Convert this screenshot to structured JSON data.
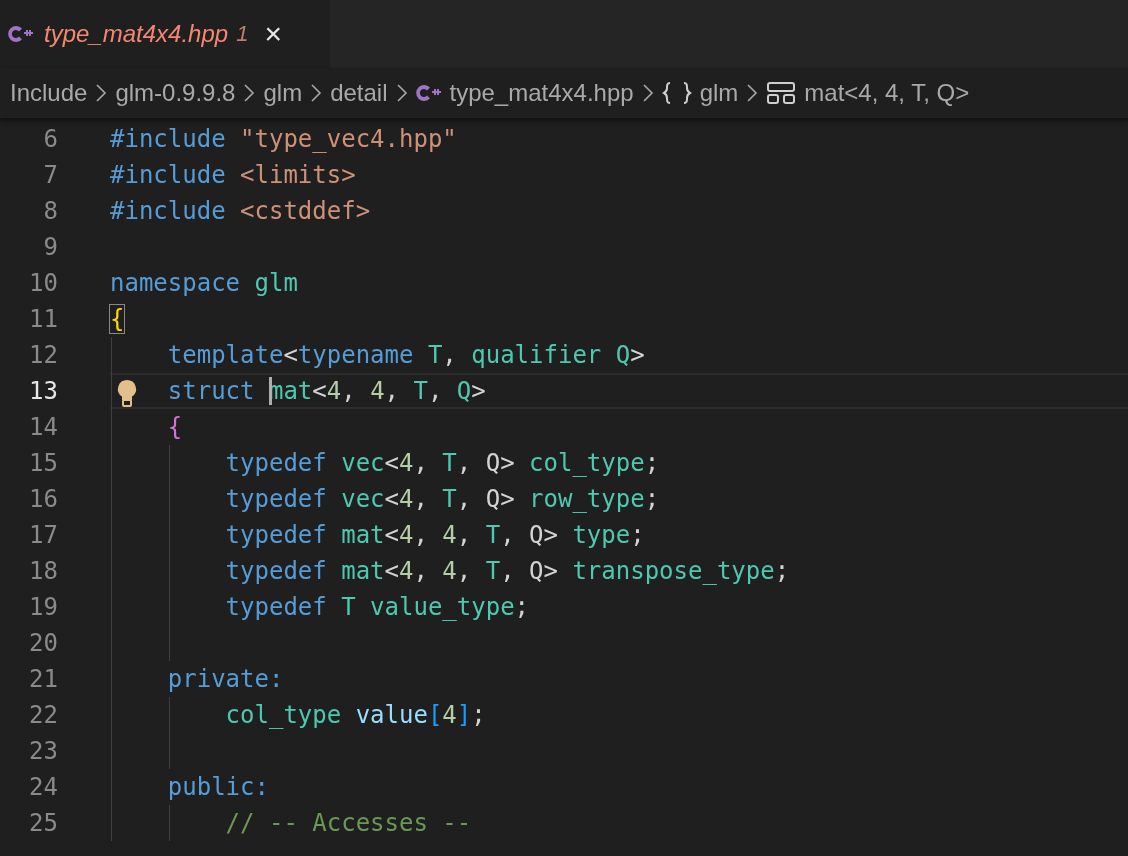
{
  "tab": {
    "title": "type_mat4x4.hpp",
    "problems": "1",
    "preview": true,
    "selected": true,
    "close": "×"
  },
  "breadcrumbs": [
    {
      "kind": "folder",
      "label": "Include"
    },
    {
      "kind": "folder",
      "label": "glm-0.9.9.8"
    },
    {
      "kind": "folder",
      "label": "glm"
    },
    {
      "kind": "folder",
      "label": "detail"
    },
    {
      "kind": "file",
      "label": "type_mat4x4.hpp"
    },
    {
      "kind": "namespace",
      "label": "glm"
    },
    {
      "kind": "struct",
      "label": "mat<4, 4, T, Q>"
    }
  ],
  "editor": {
    "lines": [
      {
        "number": "6",
        "current": false,
        "lightbulb": false,
        "tokens": [
          {
            "kind": "directive",
            "text": "#include "
          },
          {
            "kind": "string",
            "text": "\"type_vec4.hpp\""
          }
        ]
      },
      {
        "number": "7",
        "current": false,
        "lightbulb": false,
        "tokens": [
          {
            "kind": "directive",
            "text": "#include "
          },
          {
            "kind": "string",
            "text": "<limits>"
          }
        ]
      },
      {
        "number": "8",
        "current": false,
        "lightbulb": false,
        "tokens": [
          {
            "kind": "directive",
            "text": "#include "
          },
          {
            "kind": "string",
            "text": "<cstddef>"
          }
        ]
      },
      {
        "number": "9",
        "current": false,
        "lightbulb": false
      },
      {
        "number": "10",
        "current": false,
        "lightbulb": false,
        "tokens": [
          {
            "kind": "keyword",
            "text": "namespace "
          },
          {
            "kind": "type",
            "text": "glm"
          }
        ]
      },
      {
        "number": "11",
        "current": false,
        "lightbulb": false,
        "tokens": [
          {
            "kind": "brace-outer",
            "text": "{",
            "matched": true
          }
        ]
      },
      {
        "number": "12",
        "current": false,
        "lightbulb": false,
        "tokens": [
          {
            "kind": "keyword",
            "text": "    template"
          },
          {
            "kind": "punct",
            "text": "<"
          },
          {
            "kind": "keyword",
            "text": "typename "
          },
          {
            "kind": "type",
            "text": "T"
          },
          {
            "kind": "punct",
            "text": ", "
          },
          {
            "kind": "type",
            "text": "qualifier Q"
          },
          {
            "kind": "punct",
            "text": ">"
          }
        ]
      },
      {
        "number": "13",
        "current": true,
        "lightbulb": true,
        "tokens": [
          {
            "kind": "keyword",
            "text": "    struct "
          },
          {
            "kind": "type",
            "text": "mat",
            "cursor": true
          },
          {
            "kind": "punct",
            "text": "<"
          },
          {
            "kind": "number",
            "text": "4"
          },
          {
            "kind": "punct",
            "text": ", "
          },
          {
            "kind": "number",
            "text": "4"
          },
          {
            "kind": "punct",
            "text": ", "
          },
          {
            "kind": "type",
            "text": "T"
          },
          {
            "kind": "punct",
            "text": ", "
          },
          {
            "kind": "type",
            "text": "Q"
          },
          {
            "kind": "punct",
            "text": ">"
          }
        ]
      },
      {
        "number": "14",
        "current": false,
        "lightbulb": false,
        "tokens": [
          {
            "kind": "brace-inner",
            "text": "    {"
          }
        ]
      },
      {
        "number": "15",
        "current": false,
        "lightbulb": false,
        "tokens": [
          {
            "kind": "keyword",
            "text": "        typedef "
          },
          {
            "kind": "type",
            "text": "vec"
          },
          {
            "kind": "punct",
            "text": "<"
          },
          {
            "kind": "number",
            "text": "4"
          },
          {
            "kind": "punct",
            "text": ", "
          },
          {
            "kind": "type",
            "text": "T"
          },
          {
            "kind": "punct",
            "text": ", Q> "
          },
          {
            "kind": "type",
            "text": "col_type"
          },
          {
            "kind": "punct",
            "text": ";"
          }
        ]
      },
      {
        "number": "16",
        "current": false,
        "lightbulb": false,
        "tokens": [
          {
            "kind": "keyword",
            "text": "        typedef "
          },
          {
            "kind": "type",
            "text": "vec"
          },
          {
            "kind": "punct",
            "text": "<"
          },
          {
            "kind": "number",
            "text": "4"
          },
          {
            "kind": "punct",
            "text": ", "
          },
          {
            "kind": "type",
            "text": "T"
          },
          {
            "kind": "punct",
            "text": ", Q> "
          },
          {
            "kind": "type",
            "text": "row_type"
          },
          {
            "kind": "punct",
            "text": ";"
          }
        ]
      },
      {
        "number": "17",
        "current": false,
        "lightbulb": false,
        "tokens": [
          {
            "kind": "keyword",
            "text": "        typedef "
          },
          {
            "kind": "type",
            "text": "mat"
          },
          {
            "kind": "punct",
            "text": "<"
          },
          {
            "kind": "number",
            "text": "4"
          },
          {
            "kind": "punct",
            "text": ", "
          },
          {
            "kind": "number",
            "text": "4"
          },
          {
            "kind": "punct",
            "text": ", "
          },
          {
            "kind": "type",
            "text": "T"
          },
          {
            "kind": "punct",
            "text": ", Q> "
          },
          {
            "kind": "type",
            "text": "type"
          },
          {
            "kind": "punct",
            "text": ";"
          }
        ]
      },
      {
        "number": "18",
        "current": false,
        "lightbulb": false,
        "tokens": [
          {
            "kind": "keyword",
            "text": "        typedef "
          },
          {
            "kind": "type",
            "text": "mat"
          },
          {
            "kind": "punct",
            "text": "<"
          },
          {
            "kind": "number",
            "text": "4"
          },
          {
            "kind": "punct",
            "text": ", "
          },
          {
            "kind": "number",
            "text": "4"
          },
          {
            "kind": "punct",
            "text": ", "
          },
          {
            "kind": "type",
            "text": "T"
          },
          {
            "kind": "punct",
            "text": ", Q> "
          },
          {
            "kind": "type",
            "text": "transpose_type"
          },
          {
            "kind": "punct",
            "text": ";"
          }
        ]
      },
      {
        "number": "19",
        "current": false,
        "lightbulb": false,
        "tokens": [
          {
            "kind": "keyword",
            "text": "        typedef "
          },
          {
            "kind": "type",
            "text": "T value_type"
          },
          {
            "kind": "punct",
            "text": ";"
          }
        ]
      },
      {
        "number": "20",
        "current": false,
        "lightbulb": false
      },
      {
        "number": "21",
        "current": false,
        "lightbulb": false,
        "tokens": [
          {
            "kind": "keyword",
            "text": "    private:"
          }
        ]
      },
      {
        "number": "22",
        "current": false,
        "lightbulb": false,
        "tokens": [
          {
            "kind": "type",
            "text": "        col_type "
          },
          {
            "kind": "var",
            "text": "value"
          },
          {
            "kind": "bracket",
            "text": "["
          },
          {
            "kind": "number",
            "text": "4"
          },
          {
            "kind": "bracket",
            "text": "]"
          },
          {
            "kind": "punct",
            "text": ";"
          }
        ]
      },
      {
        "number": "23",
        "current": false,
        "lightbulb": false
      },
      {
        "number": "24",
        "current": false,
        "lightbulb": false,
        "tokens": [
          {
            "kind": "keyword",
            "text": "    public:"
          }
        ]
      },
      {
        "number": "25",
        "current": false,
        "lightbulb": false,
        "tokens": [
          {
            "kind": "comment",
            "text": "        // -- Accesses --"
          }
        ]
      }
    ]
  }
}
